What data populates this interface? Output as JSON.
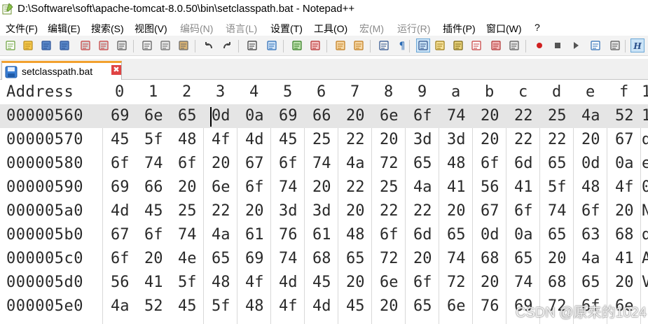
{
  "window": {
    "title": "D:\\Software\\soft\\apache-tomcat-8.0.50\\bin\\setclasspath.bat - Notepad++",
    "app_icon": "notepadpp-icon"
  },
  "menu": [
    {
      "label": "文件(F)",
      "enabled": true
    },
    {
      "label": "编辑(E)",
      "enabled": true
    },
    {
      "label": "搜索(S)",
      "enabled": true
    },
    {
      "label": "视图(V)",
      "enabled": true
    },
    {
      "label": "编码(N)",
      "enabled": false
    },
    {
      "label": "语言(L)",
      "enabled": false
    },
    {
      "label": "设置(T)",
      "enabled": true
    },
    {
      "label": "工具(O)",
      "enabled": true
    },
    {
      "label": "宏(M)",
      "enabled": false
    },
    {
      "label": "运行(R)",
      "enabled": false
    },
    {
      "label": "插件(P)",
      "enabled": true
    },
    {
      "label": "窗口(W)",
      "enabled": true
    },
    {
      "label": "?",
      "enabled": true
    }
  ],
  "toolbar_icons": [
    "new-file-icon",
    "open-file-icon",
    "save-icon",
    "save-all-icon",
    "close-icon",
    "close-all-icon",
    "print-icon",
    "cut-icon",
    "copy-icon",
    "paste-icon",
    "undo-icon",
    "redo-icon",
    "find-icon",
    "replace-icon",
    "zoom-in-icon",
    "zoom-out-icon",
    "sync-vertical-icon",
    "sync-horizontal-icon",
    "word-wrap-icon",
    "show-all-chars-icon",
    "indent-guide-icon",
    "udl-icon",
    "doc-map-icon",
    "function-list-icon",
    "folder-workspace-icon",
    "monitor-icon",
    "record-macro-icon",
    "stop-macro-icon",
    "play-macro-icon",
    "run-macro-multiple-icon",
    "save-macro-icon",
    "hex-editor-icon"
  ],
  "tabs": [
    {
      "label": "setclasspath.bat",
      "active": true,
      "close": "✖"
    }
  ],
  "hex_view": {
    "header": {
      "address": "Address",
      "columns": [
        "0",
        "1",
        "2",
        "3",
        "4",
        "5",
        "6",
        "7",
        "8",
        "9",
        "a",
        "b",
        "c",
        "d",
        "e",
        "f"
      ]
    },
    "rows": [
      {
        "address": "00000560",
        "bytes": [
          "69",
          "6e",
          "65",
          "0d",
          "0a",
          "69",
          "66",
          "20",
          "6e",
          "6f",
          "74",
          "20",
          "22",
          "25",
          "4a",
          "52"
        ],
        "selected": true
      },
      {
        "address": "00000570",
        "bytes": [
          "45",
          "5f",
          "48",
          "4f",
          "4d",
          "45",
          "25",
          "22",
          "20",
          "3d",
          "3d",
          "20",
          "22",
          "22",
          "20",
          "67"
        ]
      },
      {
        "address": "00000580",
        "bytes": [
          "6f",
          "74",
          "6f",
          "20",
          "67",
          "6f",
          "74",
          "4a",
          "72",
          "65",
          "48",
          "6f",
          "6d",
          "65",
          "0d",
          "0a"
        ]
      },
      {
        "address": "00000590",
        "bytes": [
          "69",
          "66",
          "20",
          "6e",
          "6f",
          "74",
          "20",
          "22",
          "25",
          "4a",
          "41",
          "56",
          "41",
          "5f",
          "48",
          "4f"
        ]
      },
      {
        "address": "000005a0",
        "bytes": [
          "4d",
          "45",
          "25",
          "22",
          "20",
          "3d",
          "3d",
          "20",
          "22",
          "22",
          "20",
          "67",
          "6f",
          "74",
          "6f",
          "20"
        ]
      },
      {
        "address": "000005b0",
        "bytes": [
          "67",
          "6f",
          "74",
          "4a",
          "61",
          "76",
          "61",
          "48",
          "6f",
          "6d",
          "65",
          "0d",
          "0a",
          "65",
          "63",
          "68"
        ]
      },
      {
        "address": "000005c0",
        "bytes": [
          "6f",
          "20",
          "4e",
          "65",
          "69",
          "74",
          "68",
          "65",
          "72",
          "20",
          "74",
          "68",
          "65",
          "20",
          "4a",
          "41"
        ]
      },
      {
        "address": "000005d0",
        "bytes": [
          "56",
          "41",
          "5f",
          "48",
          "4f",
          "4d",
          "45",
          "20",
          "6e",
          "6f",
          "72",
          "20",
          "74",
          "68",
          "65",
          "20"
        ]
      },
      {
        "address": "000005e0",
        "bytes": [
          "4a",
          "52",
          "45",
          "5f",
          "48",
          "4f",
          "4d",
          "45",
          "20",
          "65",
          "6e",
          "76",
          "69",
          "72",
          "6f",
          "6e"
        ]
      }
    ],
    "overflow_chars": [
      "1",
      "1",
      "d",
      "e",
      "0",
      "N",
      "d",
      "A",
      "V",
      ""
    ]
  },
  "watermark": "CSDN @原来的1024"
}
